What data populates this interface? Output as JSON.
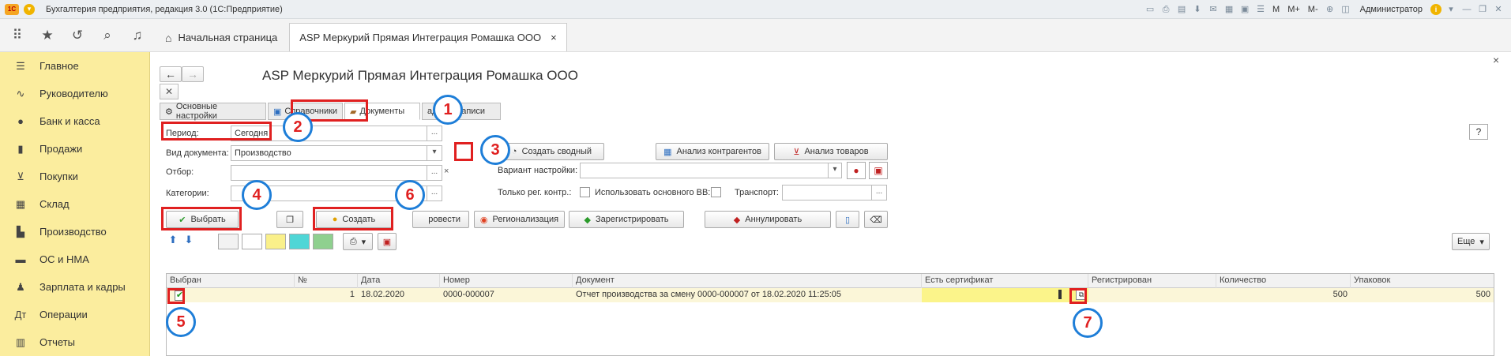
{
  "titlebar": {
    "logo": "1С",
    "title": "Бухгалтерия предприятия, редакция 3.0  (1С:Предприятие)",
    "m": "M",
    "m_plus": "M+",
    "m_minus": "M-",
    "user": "Администратор"
  },
  "tabs": [
    {
      "label": "Начальная страница"
    },
    {
      "label": "ASP Меркурий Прямая Интеграция Ромашка ООО",
      "close": "×"
    }
  ],
  "sidebar": {
    "items": [
      {
        "label": "Главное"
      },
      {
        "label": "Руководителю"
      },
      {
        "label": "Банк и касса"
      },
      {
        "label": "Продажи"
      },
      {
        "label": "Покупки"
      },
      {
        "label": "Склад"
      },
      {
        "label": "Производство"
      },
      {
        "label": "ОС и НМА"
      },
      {
        "label": "Зарплата и кадры"
      },
      {
        "label": "Операции"
      },
      {
        "label": "Отчеты"
      }
    ]
  },
  "form": {
    "title": "ASP Меркурий Прямая Интеграция Ромашка ООО",
    "close": "×",
    "help": "?",
    "tabs": {
      "settings": "Основные настройки",
      "refs": "Справочники",
      "documents": "Документы",
      "records": "адские записи"
    },
    "period_label": "Период:",
    "period_value": "Сегодня",
    "ellipsis": "...",
    "doctype_label": "Вид документа:",
    "doctype_value": "Производство",
    "filter_label": "Отбор:",
    "clear": "×",
    "categories_label": "Категории:",
    "create_summary": "Создать сводный",
    "analyze_contractors": "Анализ контрагентов",
    "analyze_goods": "Анализ товаров",
    "variant_label": "Вариант настройки:",
    "reg_only_label": "Только рег. контр.:",
    "use_main_vv_label": "Использовать основного ВВ:",
    "transport_label": "Транспорт:",
    "buttons": {
      "select": "Выбрать",
      "create": "Создать",
      "post": "ровести",
      "regionalize": "Регионализация",
      "register": "Зарегистрировать",
      "annul": "Аннулировать",
      "more": "Еще"
    }
  },
  "markers": [
    "1",
    "2",
    "3",
    "4",
    "5",
    "6",
    "7"
  ],
  "table": {
    "headers": [
      "Выбран",
      "№",
      "Дата",
      "Номер",
      "Документ",
      "Есть сертификат",
      "Регистрирован",
      "Количество",
      "Упаковок"
    ],
    "rows": [
      {
        "selected": "✔",
        "num": "1",
        "date": "18.02.2020",
        "number": "0000-000007",
        "document": "Отчет производства за смену 0000-000007 от 18.02.2020 11:25:05",
        "cert": "",
        "registered": "",
        "qty": "500",
        "packs": "500"
      }
    ]
  }
}
